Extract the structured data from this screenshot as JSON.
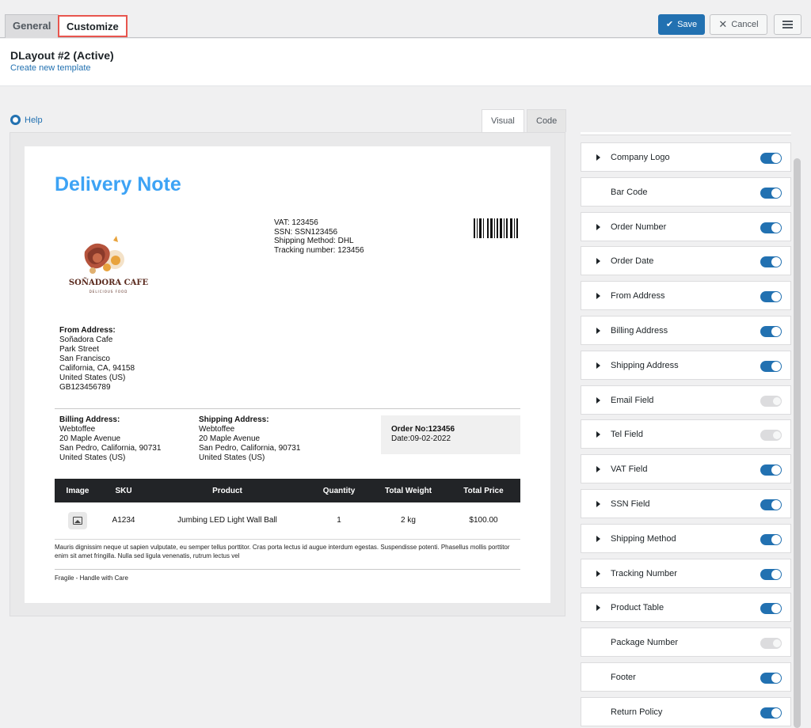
{
  "tabs": {
    "general": "General",
    "customize": "Customize"
  },
  "header": {
    "title": "DLayout #2 (Active)",
    "create_link": "Create new template",
    "save": "Save",
    "cancel": "Cancel"
  },
  "help": "Help",
  "view_tabs": {
    "visual": "Visual",
    "code": "Code"
  },
  "document": {
    "title": "Delivery Note",
    "meta": [
      "VAT: 123456",
      "SSN: SSN123456",
      "Shipping Method: DHL",
      "Tracking number: 123456"
    ],
    "logo_text": "SOÑADORA CAFE",
    "logo_sub": "DELICIOUS FOOD",
    "from": {
      "label": "From Address:",
      "lines": [
        "Soñadora Cafe",
        "Park Street",
        "San Francisco",
        "California, CA, 94158",
        "United States (US)",
        "GB123456789"
      ]
    },
    "billing": {
      "label": "Billing Address:",
      "lines": [
        "Webtoffee",
        "20 Maple Avenue",
        "San Pedro, California, 90731",
        "United States (US)"
      ]
    },
    "shipping": {
      "label": "Shipping Address:",
      "lines": [
        "Webtoffee",
        "20 Maple Avenue",
        "San Pedro, California, 90731",
        "United States (US)"
      ]
    },
    "order_no": "Order No:123456",
    "order_date": "Date:09-02-2022",
    "table": {
      "headers": [
        "Image",
        "SKU",
        "Product",
        "Quantity",
        "Total Weight",
        "Total Price"
      ],
      "row": {
        "sku": "A1234",
        "product": "Jumbing LED Light Wall Ball",
        "quantity": "1",
        "weight": "2 kg",
        "price": "$100.00"
      }
    },
    "lorem": "Mauris dignissim neque ut sapien vulputate, eu semper tellus porttitor. Cras porta lectus id augue interdum egestas. Suspendisse potenti. Phasellus mollis porttitor enim sit amet fringilla. Nulla sed ligula venenatis, rutrum lectus vel",
    "footer_note": "Fragile - Handle with Care"
  },
  "panel": [
    {
      "label": "Company Logo",
      "arrow": true,
      "on": true
    },
    {
      "label": "Bar Code",
      "arrow": false,
      "on": true
    },
    {
      "label": "Order Number",
      "arrow": true,
      "on": true
    },
    {
      "label": "Order Date",
      "arrow": true,
      "on": true
    },
    {
      "label": "From Address",
      "arrow": true,
      "on": true
    },
    {
      "label": "Billing Address",
      "arrow": true,
      "on": true
    },
    {
      "label": "Shipping Address",
      "arrow": true,
      "on": true
    },
    {
      "label": "Email Field",
      "arrow": true,
      "on": false
    },
    {
      "label": "Tel Field",
      "arrow": true,
      "on": false
    },
    {
      "label": "VAT Field",
      "arrow": true,
      "on": true
    },
    {
      "label": "SSN Field",
      "arrow": true,
      "on": true
    },
    {
      "label": "Shipping Method",
      "arrow": true,
      "on": true
    },
    {
      "label": "Tracking Number",
      "arrow": true,
      "on": true
    },
    {
      "label": "Product Table",
      "arrow": true,
      "on": true
    },
    {
      "label": "Package Number",
      "arrow": false,
      "on": false
    },
    {
      "label": "Footer",
      "arrow": false,
      "on": true
    },
    {
      "label": "Return Policy",
      "arrow": false,
      "on": true
    }
  ]
}
